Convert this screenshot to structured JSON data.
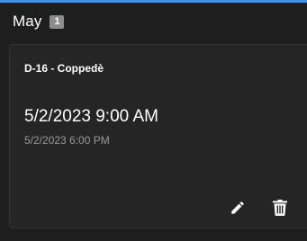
{
  "header": {
    "month": "May",
    "count": "1"
  },
  "events": [
    {
      "title": "D-16 - Coppedè",
      "start": "5/2/2023 9:00 AM",
      "end": "5/2/2023 6:00 PM",
      "actions": {
        "edit_icon": "pencil-icon",
        "delete_icon": "trash-icon"
      }
    }
  ],
  "colors": {
    "background": "#1e1e1e",
    "card": "#252525",
    "accent": "#4a90d9",
    "badge": "#8c8c8c",
    "secondary_text": "#9a9a9a"
  }
}
